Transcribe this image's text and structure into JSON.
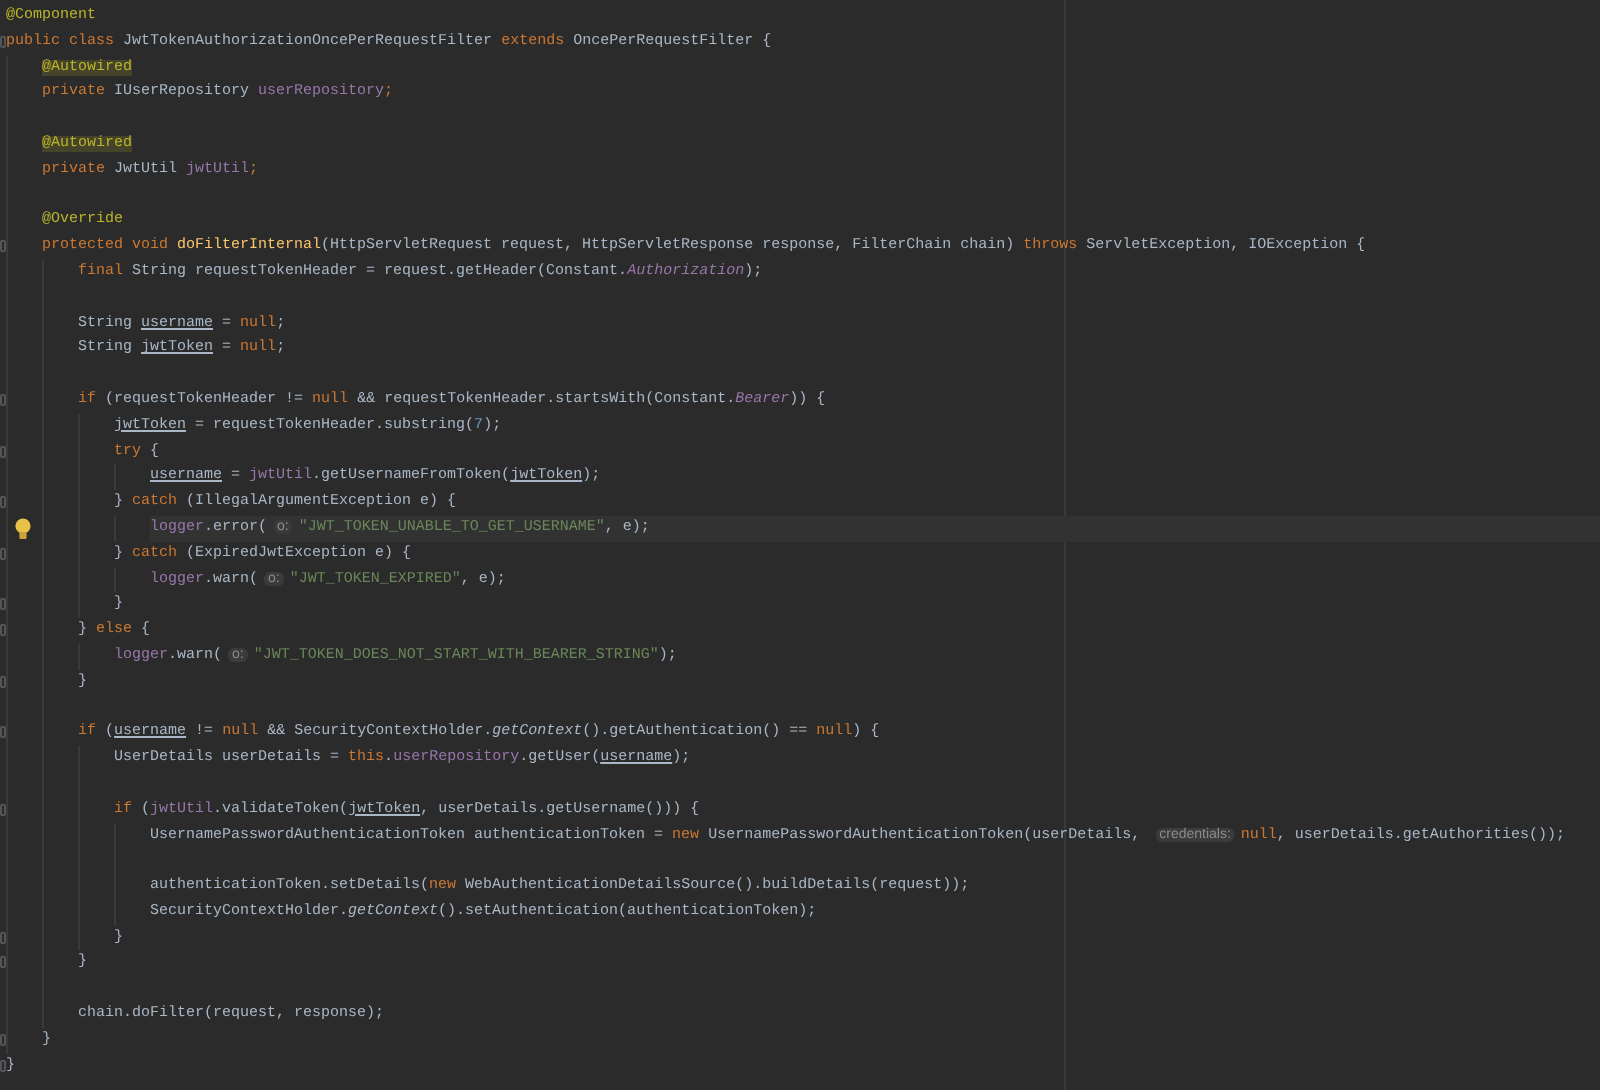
{
  "editor": {
    "lines": [
      {
        "kind": "code",
        "tokens": [
          {
            "kind": "annotation",
            "text": "@Component"
          }
        ]
      },
      {
        "kind": "code",
        "tokens": [
          {
            "kind": "keyword",
            "text": "public class"
          },
          {
            "kind": "plain",
            "text": " JwtTokenAuthorizationOncePerRequestFilter "
          },
          {
            "kind": "keyword",
            "text": "extends"
          },
          {
            "kind": "plain",
            "text": " OncePerRequestFilter {"
          }
        ],
        "children": [
          {
            "kind": "code",
            "tokens": [
              {
                "kind": "annotation-warning",
                "text": "@Autowired"
              }
            ]
          },
          {
            "kind": "code",
            "tokens": [
              {
                "kind": "keyword",
                "text": "private"
              },
              {
                "kind": "plain",
                "text": " IUserRepository "
              },
              {
                "kind": "field",
                "text": "userRepository"
              },
              {
                "kind": "keyword",
                "text": ";"
              }
            ]
          },
          {
            "kind": "blank"
          },
          {
            "kind": "code",
            "tokens": [
              {
                "kind": "annotation-warning",
                "text": "@Autowired"
              }
            ]
          },
          {
            "kind": "code",
            "tokens": [
              {
                "kind": "keyword",
                "text": "private"
              },
              {
                "kind": "plain",
                "text": " JwtUtil "
              },
              {
                "kind": "field",
                "text": "jwtUtil"
              },
              {
                "kind": "keyword",
                "text": ";"
              }
            ]
          },
          {
            "kind": "blank"
          },
          {
            "kind": "code",
            "tokens": [
              {
                "kind": "annotation",
                "text": "@Override"
              }
            ]
          },
          {
            "kind": "code",
            "tokens": [
              {
                "kind": "keyword",
                "text": "protected void "
              },
              {
                "kind": "method",
                "text": "doFilterInternal"
              },
              {
                "kind": "plain",
                "text": "(HttpServletRequest request, HttpServletResponse response, FilterChain chain) "
              },
              {
                "kind": "keyword",
                "text": "throws"
              },
              {
                "kind": "plain",
                "text": " ServletException, IOException {"
              }
            ],
            "children": [
              {
                "kind": "code",
                "tokens": [
                  {
                    "kind": "keyword",
                    "text": "final "
                  },
                  {
                    "kind": "plain",
                    "text": "String requestTokenHeader = request.getHeader(Constant."
                  },
                  {
                    "kind": "static",
                    "text": "Authorization"
                  },
                  {
                    "kind": "plain",
                    "text": ");"
                  }
                ]
              },
              {
                "kind": "blank"
              },
              {
                "kind": "code",
                "tokens": [
                  {
                    "kind": "plain",
                    "text": "String "
                  },
                  {
                    "kind": "reassigned",
                    "text": "username"
                  },
                  {
                    "kind": "plain",
                    "text": " = "
                  },
                  {
                    "kind": "keyword",
                    "text": "null"
                  },
                  {
                    "kind": "plain",
                    "text": ";"
                  }
                ]
              },
              {
                "kind": "code",
                "tokens": [
                  {
                    "kind": "plain",
                    "text": "String "
                  },
                  {
                    "kind": "reassigned",
                    "text": "jwtToken"
                  },
                  {
                    "kind": "plain",
                    "text": " = "
                  },
                  {
                    "kind": "keyword",
                    "text": "null"
                  },
                  {
                    "kind": "plain",
                    "text": ";"
                  }
                ]
              },
              {
                "kind": "blank"
              },
              {
                "kind": "code",
                "tokens": [
                  {
                    "kind": "keyword",
                    "text": "if "
                  },
                  {
                    "kind": "plain",
                    "text": "(requestTokenHeader != "
                  },
                  {
                    "kind": "keyword",
                    "text": "null"
                  },
                  {
                    "kind": "plain",
                    "text": " && requestTokenHeader.startsWith(Constant."
                  },
                  {
                    "kind": "static",
                    "text": "Bearer"
                  },
                  {
                    "kind": "plain",
                    "text": ")) {"
                  }
                ],
                "children": [
                  {
                    "kind": "code",
                    "tokens": [
                      {
                        "kind": "reassigned",
                        "text": "jwtToken"
                      },
                      {
                        "kind": "plain",
                        "text": " = requestTokenHeader.substring("
                      },
                      {
                        "kind": "number",
                        "text": "7"
                      },
                      {
                        "kind": "plain",
                        "text": ");"
                      }
                    ]
                  },
                  {
                    "kind": "code",
                    "tokens": [
                      {
                        "kind": "keyword",
                        "text": "try"
                      },
                      {
                        "kind": "plain",
                        "text": " {"
                      }
                    ],
                    "children": [
                      {
                        "kind": "code",
                        "tokens": [
                          {
                            "kind": "reassigned",
                            "text": "username"
                          },
                          {
                            "kind": "plain",
                            "text": " = "
                          },
                          {
                            "kind": "field",
                            "text": "jwtUtil"
                          },
                          {
                            "kind": "plain",
                            "text": ".getUsernameFromToken("
                          },
                          {
                            "kind": "reassigned",
                            "text": "jwtToken"
                          },
                          {
                            "kind": "plain",
                            "text": ");"
                          }
                        ]
                      }
                    ]
                  },
                  {
                    "kind": "code",
                    "tokens": [
                      {
                        "kind": "plain",
                        "text": "} "
                      },
                      {
                        "kind": "keyword",
                        "text": "catch"
                      },
                      {
                        "kind": "plain",
                        "text": " (IllegalArgumentException e) {"
                      }
                    ],
                    "children": [
                      {
                        "kind": "code",
                        "current": true,
                        "tokens": [
                          {
                            "kind": "field",
                            "text": "logger"
                          },
                          {
                            "kind": "plain",
                            "text": ".error("
                          },
                          {
                            "kind": "hint",
                            "text": "o:"
                          },
                          {
                            "kind": "string",
                            "text": "\"JWT_TOKEN_UNABLE_TO_GET_USERNAME\""
                          },
                          {
                            "kind": "plain",
                            "text": ", e);"
                          }
                        ]
                      }
                    ]
                  },
                  {
                    "kind": "code",
                    "tokens": [
                      {
                        "kind": "plain",
                        "text": "} "
                      },
                      {
                        "kind": "keyword",
                        "text": "catch"
                      },
                      {
                        "kind": "plain",
                        "text": " (ExpiredJwtException e) {"
                      }
                    ],
                    "children": [
                      {
                        "kind": "code",
                        "tokens": [
                          {
                            "kind": "field",
                            "text": "logger"
                          },
                          {
                            "kind": "plain",
                            "text": ".warn("
                          },
                          {
                            "kind": "hint",
                            "text": "o:"
                          },
                          {
                            "kind": "string",
                            "text": "\"JWT_TOKEN_EXPIRED\""
                          },
                          {
                            "kind": "plain",
                            "text": ", e);"
                          }
                        ]
                      }
                    ]
                  },
                  {
                    "kind": "code",
                    "tokens": [
                      {
                        "kind": "plain",
                        "text": "}"
                      }
                    ]
                  }
                ]
              },
              {
                "kind": "code",
                "tokens": [
                  {
                    "kind": "plain",
                    "text": "} "
                  },
                  {
                    "kind": "keyword",
                    "text": "else"
                  },
                  {
                    "kind": "plain",
                    "text": " {"
                  }
                ],
                "children": [
                  {
                    "kind": "code",
                    "tokens": [
                      {
                        "kind": "field",
                        "text": "logger"
                      },
                      {
                        "kind": "plain",
                        "text": ".warn("
                      },
                      {
                        "kind": "hint",
                        "text": "o:"
                      },
                      {
                        "kind": "string",
                        "text": "\"JWT_TOKEN_DOES_NOT_START_WITH_BEARER_STRING\""
                      },
                      {
                        "kind": "plain",
                        "text": ");"
                      }
                    ]
                  }
                ]
              },
              {
                "kind": "code",
                "tokens": [
                  {
                    "kind": "plain",
                    "text": "}"
                  }
                ]
              },
              {
                "kind": "blank"
              },
              {
                "kind": "code",
                "tokens": [
                  {
                    "kind": "keyword",
                    "text": "if "
                  },
                  {
                    "kind": "plain",
                    "text": "("
                  },
                  {
                    "kind": "reassigned",
                    "text": "username"
                  },
                  {
                    "kind": "plain",
                    "text": " != "
                  },
                  {
                    "kind": "keyword",
                    "text": "null"
                  },
                  {
                    "kind": "plain",
                    "text": " && SecurityContextHolder."
                  },
                  {
                    "kind": "italic",
                    "text": "getContext"
                  },
                  {
                    "kind": "plain",
                    "text": "().getAuthentication() == "
                  },
                  {
                    "kind": "keyword",
                    "text": "null"
                  },
                  {
                    "kind": "plain",
                    "text": ") {"
                  }
                ],
                "children": [
                  {
                    "kind": "code",
                    "tokens": [
                      {
                        "kind": "plain",
                        "text": "UserDetails userDetails = "
                      },
                      {
                        "kind": "keyword",
                        "text": "this"
                      },
                      {
                        "kind": "plain",
                        "text": "."
                      },
                      {
                        "kind": "field",
                        "text": "userRepository"
                      },
                      {
                        "kind": "plain",
                        "text": ".getUser("
                      },
                      {
                        "kind": "reassigned",
                        "text": "username"
                      },
                      {
                        "kind": "plain",
                        "text": ");"
                      }
                    ]
                  },
                  {
                    "kind": "blank"
                  },
                  {
                    "kind": "code",
                    "tokens": [
                      {
                        "kind": "keyword",
                        "text": "if "
                      },
                      {
                        "kind": "plain",
                        "text": "("
                      },
                      {
                        "kind": "field",
                        "text": "jwtUtil"
                      },
                      {
                        "kind": "plain",
                        "text": ".validateToken("
                      },
                      {
                        "kind": "reassigned",
                        "text": "jwtToken"
                      },
                      {
                        "kind": "plain",
                        "text": ", userDetails.getUsername())) {"
                      }
                    ],
                    "children": [
                      {
                        "kind": "code",
                        "tokens": [
                          {
                            "kind": "plain",
                            "text": "UsernamePasswordAuthenticationToken authenticationToken = "
                          },
                          {
                            "kind": "keyword",
                            "text": "new"
                          },
                          {
                            "kind": "plain",
                            "text": " UsernamePasswordAuthenticationToken(userDetails, "
                          },
                          {
                            "kind": "hint",
                            "text": "credentials:"
                          },
                          {
                            "kind": "keyword",
                            "text": "null"
                          },
                          {
                            "kind": "plain",
                            "text": ", userDetails.getAuthorities());"
                          }
                        ]
                      },
                      {
                        "kind": "blank"
                      },
                      {
                        "kind": "code",
                        "tokens": [
                          {
                            "kind": "plain",
                            "text": "authenticationToken.setDetails("
                          },
                          {
                            "kind": "keyword",
                            "text": "new"
                          },
                          {
                            "kind": "plain",
                            "text": " WebAuthenticationDetailsSource().buildDetails(request));"
                          }
                        ]
                      },
                      {
                        "kind": "code",
                        "tokens": [
                          {
                            "kind": "plain",
                            "text": "SecurityContextHolder."
                          },
                          {
                            "kind": "italic",
                            "text": "getContext"
                          },
                          {
                            "kind": "plain",
                            "text": "().setAuthentication(authenticationToken);"
                          }
                        ]
                      }
                    ]
                  },
                  {
                    "kind": "code",
                    "tokens": [
                      {
                        "kind": "plain",
                        "text": "}"
                      }
                    ]
                  }
                ]
              },
              {
                "kind": "code",
                "tokens": [
                  {
                    "kind": "plain",
                    "text": "}"
                  }
                ]
              },
              {
                "kind": "blank"
              },
              {
                "kind": "code",
                "tokens": [
                  {
                    "kind": "plain",
                    "text": "chain.doFilter(request, response);"
                  }
                ]
              }
            ]
          },
          {
            "kind": "code",
            "tokens": [
              {
                "kind": "plain",
                "text": "}"
              }
            ]
          }
        ]
      },
      {
        "kind": "code",
        "tokens": [
          {
            "kind": "plain",
            "text": "}"
          }
        ]
      }
    ]
  }
}
